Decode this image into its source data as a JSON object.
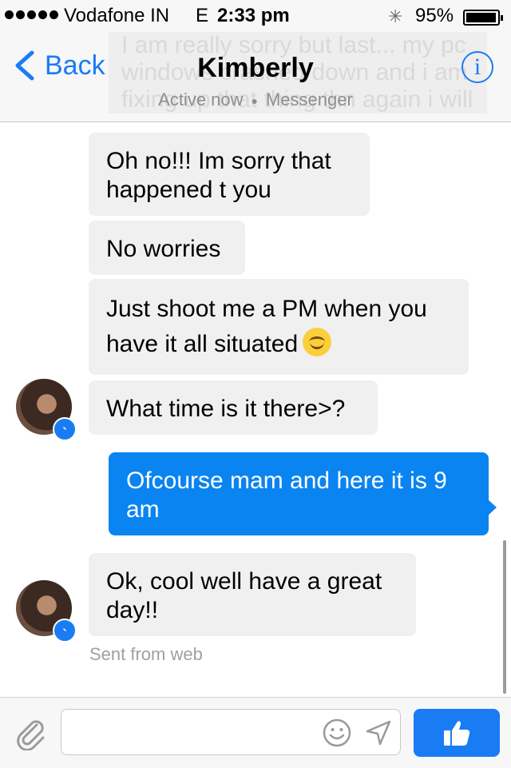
{
  "status_bar": {
    "carrier": "Vodafone IN",
    "network": "E",
    "time": "2:33 pm",
    "battery": "95%",
    "battery_level": 0.95
  },
  "nav": {
    "back_label": "Back",
    "title": "Kimberly",
    "status": "Active now",
    "platform": "Messenger",
    "info_label": "i",
    "ghost_text": "I am really sorry but last... my pc windows crashed down and i am fixing up that thing thn again i will register it"
  },
  "messages": [
    {
      "from": "them",
      "text": "Oh no!!!  Im sorry that happened t you"
    },
    {
      "from": "them",
      "text": "No worries"
    },
    {
      "from": "them",
      "text": "Just shoot me a PM when you have it all situated",
      "emoji": "smiling-face"
    },
    {
      "from": "them",
      "text": "What time is it there>?"
    },
    {
      "from": "me",
      "text": "Ofcourse mam and here it is 9 am"
    },
    {
      "from": "them",
      "text": "Ok, cool well have a great day!!"
    }
  ],
  "sent_from": "Sent from web",
  "composer": {
    "placeholder": "",
    "value": ""
  },
  "colors": {
    "accent": "#1a7cf5",
    "outgoing_bubble": "#0a84f0",
    "incoming_bubble": "#f1f0f0"
  },
  "icons": [
    "back-chevron-icon",
    "info-icon",
    "messenger-badge-icon",
    "paperclip-icon",
    "smiley-icon",
    "send-arrow-icon",
    "thumbs-up-icon"
  ]
}
